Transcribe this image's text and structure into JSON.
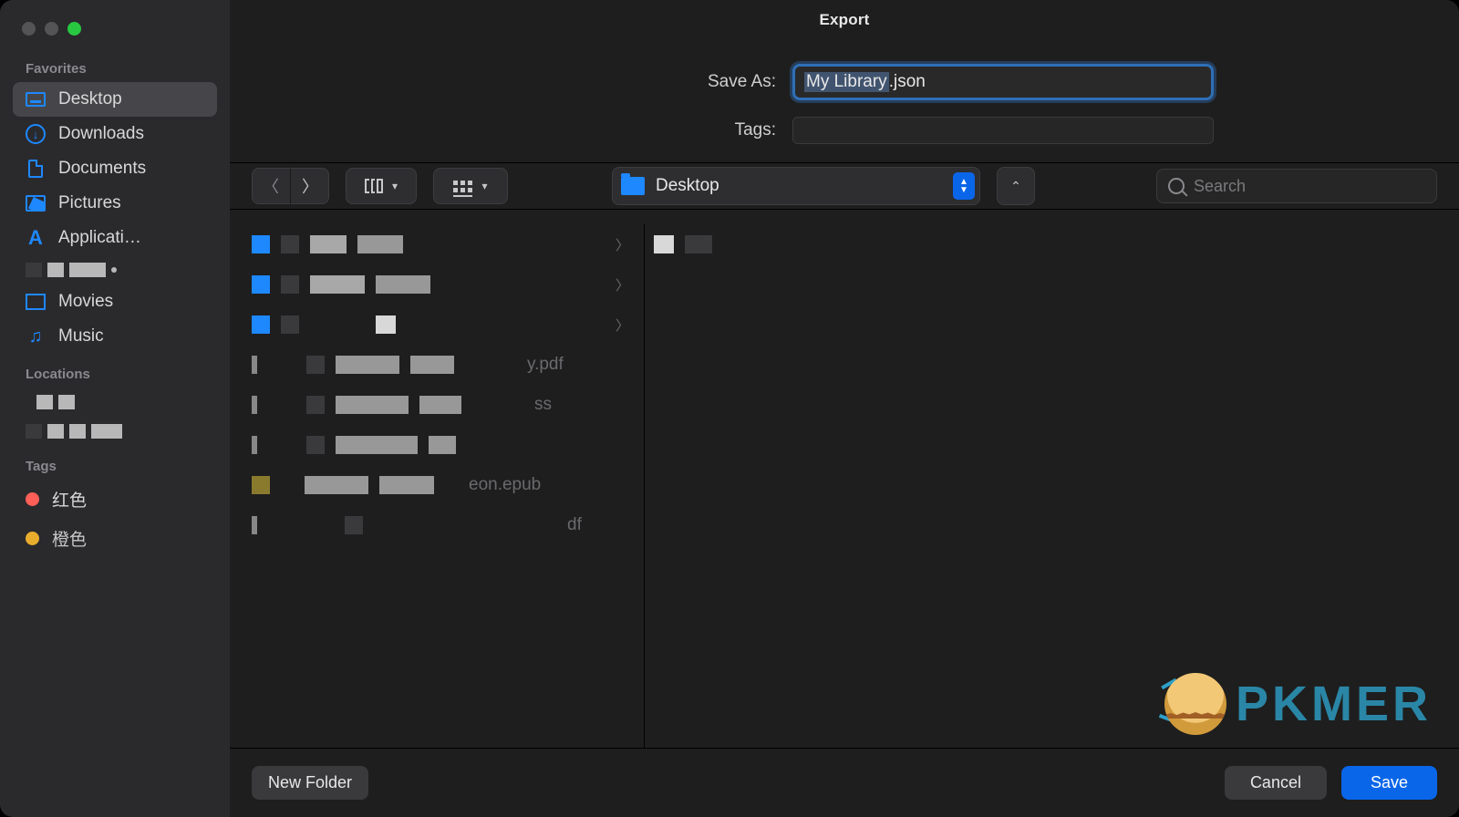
{
  "title": "Export",
  "form": {
    "save_as_label": "Save As:",
    "save_as_value_selected": "My Library",
    "save_as_value_suffix": ".json",
    "tags_label": "Tags:"
  },
  "location": {
    "name": "Desktop"
  },
  "search": {
    "placeholder": "Search"
  },
  "sidebar": {
    "favorites_label": "Favorites",
    "locations_label": "Locations",
    "tags_label": "Tags",
    "items": [
      {
        "label": "Desktop"
      },
      {
        "label": "Downloads"
      },
      {
        "label": "Documents"
      },
      {
        "label": "Pictures"
      },
      {
        "label": "Applicati…"
      },
      {
        "label": "Movies"
      },
      {
        "label": "Music"
      }
    ],
    "tags": [
      {
        "label": "红色"
      },
      {
        "label": "橙色"
      }
    ]
  },
  "files": {
    "partial_names": [
      {
        "suffix": "y.pdf"
      },
      {
        "suffix": "ss"
      },
      {
        "suffix": "eon.epub"
      },
      {
        "suffix": "df"
      }
    ]
  },
  "footer": {
    "new_folder": "New Folder",
    "cancel": "Cancel",
    "save": "Save"
  },
  "watermark": {
    "text": "PKMER"
  }
}
